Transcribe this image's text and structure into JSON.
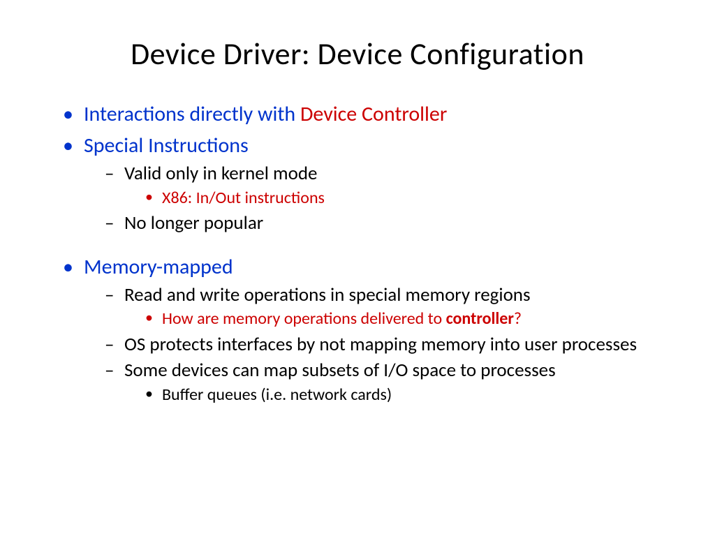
{
  "title": "Device Driver: Device Configuration",
  "b1_prefix": "Interactions directly with ",
  "b1_suffix": "Device Controller",
  "b2": "Special Instructions",
  "b2_1": "Valid only in kernel mode",
  "b2_1_1": "X86: In/Out instructions",
  "b2_2": "No longer popular",
  "b3": "Memory-mapped",
  "b3_1": "Read and write operations in special memory regions",
  "b3_1_1_prefix": "How are memory operations delivered to ",
  "b3_1_1_bold": "controller",
  "b3_1_1_suffix": "?",
  "b3_2": "OS protects interfaces by not mapping memory into user processes",
  "b3_3": "Some devices can map subsets of I/O space to processes",
  "b3_3_1": "Buffer queues (i.e. network cards)"
}
